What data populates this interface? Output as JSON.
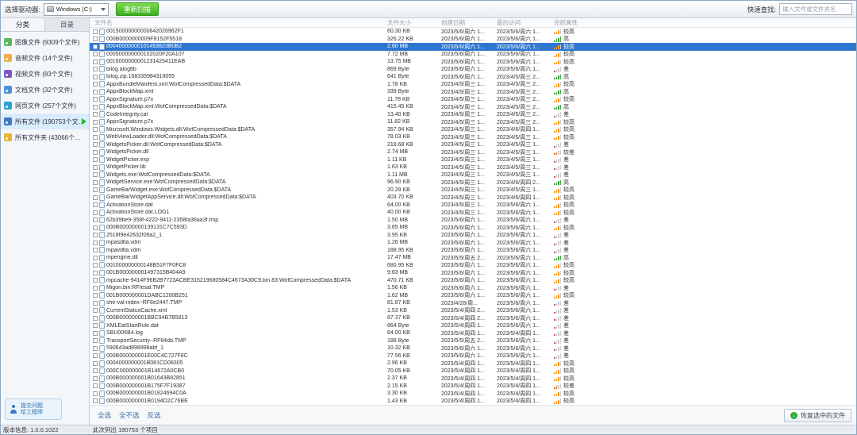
{
  "toolbar": {
    "drive_label": "选择驱动器:",
    "drive_value": "Windows (C:)",
    "rescan_label": "重新扫描",
    "search_label": "快速查找:",
    "search_placeholder": "输入文件或文件夹名"
  },
  "sidebar": {
    "tabs": [
      {
        "label": "分类",
        "active": true
      },
      {
        "label": "目录",
        "active": false
      }
    ],
    "items": [
      {
        "label": "图像文件 (9309个文件)",
        "icon": "image-files-icon",
        "color": "#5cb85c",
        "selected": false
      },
      {
        "label": "音频文件 (14个文件)",
        "icon": "audio-files-icon",
        "color": "#f0ad4e",
        "selected": false
      },
      {
        "label": "视频文件 (83个文件)",
        "icon": "video-files-icon",
        "color": "#7e57c2",
        "selected": false
      },
      {
        "label": "文档文件 (32个文件)",
        "icon": "doc-files-icon",
        "color": "#4a90d9",
        "selected": false
      },
      {
        "label": "网页文件 (257个文件)",
        "icon": "web-files-icon",
        "color": "#29a3cc",
        "selected": false
      },
      {
        "label": "所有文件 (190753个文件)",
        "icon": "all-files-icon",
        "color": "#3f78c3",
        "selected": true
      },
      {
        "label": "所有文件夹 (43066个文件夹)",
        "icon": "folder-icon",
        "color": "#e8b339",
        "selected": false
      }
    ],
    "feedback_line1": "提交问题",
    "feedback_line2": "给工程师"
  },
  "table": {
    "columns": [
      "文件名",
      "文件大小",
      "创建日期",
      "最后访问",
      "完损属性"
    ],
    "selected_index": 2,
    "rows": [
      {
        "name": "00150000000000642026962F1",
        "size": "60.30 KB",
        "created": "2023/5/6/周六 1...",
        "accessed": "2023/5/6/周六 1...",
        "quality": "较高"
      },
      {
        "name": "000B0000000009F9152F5518",
        "size": "326.22 KB",
        "created": "2023/5/6/周六 1...",
        "accessed": "2023/5/6/周六 1...",
        "quality": "高"
      },
      {
        "name": "00040000000101493823B0B2",
        "size": "2.60 MB",
        "created": "2023/5/6/周六 1...",
        "accessed": "2023/5/6/周六 1...",
        "quality": "较高"
      },
      {
        "name": "000500000000102020F20A107",
        "size": "7.72 MB",
        "created": "2023/5/6/周六 1...",
        "accessed": "2023/5/6/周六 1...",
        "quality": "较高"
      },
      {
        "name": "0016000000001231425411EAB",
        "size": "13.75 MB",
        "created": "2023/5/6/周六 1...",
        "accessed": "2023/5/6/周六 1...",
        "quality": "较高"
      },
      {
        "name": "bilog.alog6b",
        "size": "869 Byte",
        "created": "2023/5/6/周六 1...",
        "accessed": "2023/5/6/周六 1...",
        "quality": "差"
      },
      {
        "name": "bilog.zip.168335984318055",
        "size": "641 Byte",
        "created": "2023/5/6/周六 1...",
        "accessed": "2023/4/5/周三 2...",
        "quality": "高"
      },
      {
        "name": "AppxBundleManifest.xml:WofCompressedData:$DATA",
        "size": "1.78 KB",
        "created": "2023/4/5/周三 1...",
        "accessed": "2023/4/5/周三 2...",
        "quality": "较高"
      },
      {
        "name": "AppxBlockMap.xml",
        "size": "339 Byte",
        "created": "2023/4/5/周三 1...",
        "accessed": "2023/4/5/周三 2...",
        "quality": "高"
      },
      {
        "name": "AppxSignature.p7x",
        "size": "11.78 KB",
        "created": "2023/4/5/周三 1...",
        "accessed": "2023/4/5/周三 2...",
        "quality": "较高"
      },
      {
        "name": "AppxBlockMap.xml:WofCompressedData:$DATA",
        "size": "415.45 KB",
        "created": "2023/4/5/周三 1...",
        "accessed": "2023/4/5/周三 2...",
        "quality": "高"
      },
      {
        "name": "CodeIntegrity.cat",
        "size": "13.40 KB",
        "created": "2023/4/5/周三 1...",
        "accessed": "2023/4/5/周三 2...",
        "quality": "差"
      },
      {
        "name": "AppxSignature.p7x",
        "size": "11.82 KB",
        "created": "2023/4/5/周三 1...",
        "accessed": "2023/4/5/周三 2...",
        "quality": "较高"
      },
      {
        "name": "Microsoft.Windows.Widgets.dll:WofCompressedData:$DATA",
        "size": "357.94 KB",
        "created": "2023/4/5/周三 1...",
        "accessed": "2023/4/6/周四 1...",
        "quality": "较高"
      },
      {
        "name": "WebViewLoader.dll:WofCompressedData:$DATA",
        "size": "78.03 KB",
        "created": "2023/4/5/周三 1...",
        "accessed": "2023/4/5/周三 1...",
        "quality": "较高"
      },
      {
        "name": "WidgetsPicker.dll:WofCompressedData:$DATA",
        "size": "218.68 KB",
        "created": "2023/4/5/周三 1...",
        "accessed": "2023/4/5/周三 1...",
        "quality": "差"
      },
      {
        "name": "WidgetsPicker.dll",
        "size": "2.74 MB",
        "created": "2023/4/5/周三 1...",
        "accessed": "2023/4/5/周三 1...",
        "quality": "较差"
      },
      {
        "name": "WidgetPicker.exp",
        "size": "1.11 KB",
        "created": "2023/4/5/周三 1...",
        "accessed": "2023/4/5/周三 1...",
        "quality": "差"
      },
      {
        "name": "WidgetPicker.lib",
        "size": "1.63 KB",
        "created": "2023/4/5/周三 1...",
        "accessed": "2023/4/5/周三 1...",
        "quality": "差"
      },
      {
        "name": "Widgets.exe:WofCompressedData:$DATA",
        "size": "1.11 MB",
        "created": "2023/4/5/周三 1...",
        "accessed": "2023/4/5/周三 1...",
        "quality": "差"
      },
      {
        "name": "WidgetService.exe:WofCompressedData:$DATA",
        "size": "96.90 KB",
        "created": "2023/4/5/周三 1...",
        "accessed": "2023/4/6/周四 2...",
        "quality": "高"
      },
      {
        "name": "GameBarWidget.exe:WofCompressedData:$DATA",
        "size": "20.29 KB",
        "created": "2023/4/5/周三 1...",
        "accessed": "2023/4/5/周三 1...",
        "quality": "较高"
      },
      {
        "name": "GameBarWidgetAppService.dll:WofCompressedData:$DATA",
        "size": "403.70 KB",
        "created": "2023/4/5/周三 1...",
        "accessed": "2023/4/6/周四 1...",
        "quality": "较高"
      },
      {
        "name": "ActivationStore.dat",
        "size": "64.00 KB",
        "created": "2023/4/5/周三 1...",
        "accessed": "2023/5/6/周六 1...",
        "quality": "较高"
      },
      {
        "name": "ActivationStore.dat.LOG1",
        "size": "40.00 KB",
        "created": "2023/4/5/周三 1...",
        "accessed": "2023/5/6/周六 1...",
        "quality": "较高"
      },
      {
        "name": "62b39be9-358f-4222-9411-2358fa36aa3f.tmp",
        "size": "1.50 MB",
        "created": "2023/5/6/周六 1...",
        "accessed": "2023/5/6/周六 1...",
        "quality": "差"
      },
      {
        "name": "000B00000000139131C7C593D",
        "size": "3.65 MB",
        "created": "2023/5/6/周六 1...",
        "accessed": "2023/5/6/周六 1...",
        "quality": "较高"
      },
      {
        "name": "2518f9e42632f09a2_1",
        "size": "3.95 KB",
        "created": "2023/5/6/周六 1...",
        "accessed": "2023/5/6/周六 1...",
        "quality": "差"
      },
      {
        "name": "mpasdlta.vdm",
        "size": "1.26 MB",
        "created": "2023/5/6/周六 1...",
        "accessed": "2023/5/6/周六 1...",
        "quality": "差"
      },
      {
        "name": "mpavdlta.vdm",
        "size": "188.95 KB",
        "created": "2023/5/6/周六 1...",
        "accessed": "2023/5/6/周六 1...",
        "quality": "差"
      },
      {
        "name": "mpengine.dll",
        "size": "17.47 MB",
        "created": "2023/5/5/周五 2...",
        "accessed": "2023/5/6/周六 1...",
        "quality": "高"
      },
      {
        "name": "001000000000148B51F7F0FC8",
        "size": "680.95 KB",
        "created": "2023/5/6/周六 1...",
        "accessed": "2023/5/6/周六 1...",
        "quality": "较高"
      },
      {
        "name": "001B000000001497315B404A9",
        "size": "9.63 MB",
        "created": "2023/5/6/周六 1...",
        "accessed": "2023/5/6/周六 1...",
        "quality": "较高"
      },
      {
        "name": "mpcache-9414F96B2B7723ACBE315219680584C4673A30C9.bin.83:WofCompressedData:$DATA",
        "size": "470.71 KB",
        "created": "2023/5/6/周六 1...",
        "accessed": "2023/5/6/周六 1...",
        "quality": "较高"
      },
      {
        "name": "Migori.bin:RFIesal.TMP",
        "size": "1.56 KB",
        "created": "2023/5/6/周六 1...",
        "accessed": "2023/5/6/周六 1...",
        "quality": "差"
      },
      {
        "name": "001B000000001DABC1200B251",
        "size": "1.62 MB",
        "created": "2023/5/6/周六 1...",
        "accessed": "2023/5/6/周六 1...",
        "quality": "较高"
      },
      {
        "name": "she-val-index~RF8e2447.TMP",
        "size": "81.87 KB",
        "created": "2023/4/28/周...",
        "accessed": "2023/5/6/周六 1...",
        "quality": "差"
      },
      {
        "name": "CurrentStatusCache.xml",
        "size": "1.53 KB",
        "created": "2023/5/4/周四 2...",
        "accessed": "2023/5/6/周六 1...",
        "quality": "差"
      },
      {
        "name": "000B000000001BBC94B7B5813",
        "size": "87.37 KB",
        "created": "2023/5/4/周四 2...",
        "accessed": "2023/5/6/周六 1...",
        "quality": "差"
      },
      {
        "name": "XMLEatStartRule.dat",
        "size": "864 Byte",
        "created": "2023/5/4/周四 1...",
        "accessed": "2023/5/6/周六 1...",
        "quality": "差"
      },
      {
        "name": "SBU006B4.log",
        "size": "64.00 KB",
        "created": "2023/5/4/周四 1...",
        "accessed": "2023/5/4/周四 1...",
        "quality": "差"
      },
      {
        "name": "TransportSecurity~RF84db.TMP",
        "size": "188 Byte",
        "created": "2023/5/5/周五 2...",
        "accessed": "2023/5/6/周六 1...",
        "quality": "差"
      },
      {
        "name": "590643ad898998abf_1",
        "size": "10.32 KB",
        "created": "2023/5/6/周六 1...",
        "accessed": "2023/5/6/周六 1...",
        "quality": "差"
      },
      {
        "name": "000B000000001E00C4C727F8C",
        "size": "77.56 KB",
        "created": "2023/5/6/周六 1...",
        "accessed": "2023/5/6/周六 1...",
        "quality": "差"
      },
      {
        "name": "0004000000001B081CD08305",
        "size": "2.96 KB",
        "created": "2023/5/4/周四 1...",
        "accessed": "2023/5/4/周四 1...",
        "quality": "较高"
      },
      {
        "name": "000C000000001B14672A0CB0",
        "size": "70.05 KB",
        "created": "2023/5/4/周四 1...",
        "accessed": "2023/5/4/周四 1...",
        "quality": "较高"
      },
      {
        "name": "000B000000001B01643B82851",
        "size": "2.37 KB",
        "created": "2023/5/4/周四 1...",
        "accessed": "2023/5/4/周四 1...",
        "quality": "较高"
      },
      {
        "name": "000B000000001B175F7F19387",
        "size": "2.15 KB",
        "created": "2023/5/4/周四 1...",
        "accessed": "2023/5/4/周四 1...",
        "quality": "较差"
      },
      {
        "name": "000B000000001B01824694C0A",
        "size": "3.30 KB",
        "created": "2023/5/4/周四 1...",
        "accessed": "2023/5/4/周四 1...",
        "quality": "较高"
      },
      {
        "name": "000B000000001B0194D2C76BE",
        "size": "1.43 KB",
        "created": "2023/5/4/周四 1...",
        "accessed": "2023/5/4/周四 1...",
        "quality": "较高"
      }
    ]
  },
  "footer": {
    "select_all": "全选",
    "select_none": "全不选",
    "invert": "反选",
    "recover_label": "恢复选中的文件"
  },
  "statusbar": {
    "version": "版本信息: 1.0.0.1022",
    "listed": "此次列出 190753 个项目"
  },
  "colors": {
    "accent_green": "#3cb01e",
    "selection_blue": "#2e77d0",
    "quality": {
      "高": "#3aa63a",
      "较高": "#f59a23",
      "较差": "#e2711d",
      "差": "#d9534f"
    }
  },
  "quality_levels": {
    "高": 4,
    "较高": 3,
    "较差": 2,
    "差": 1
  }
}
